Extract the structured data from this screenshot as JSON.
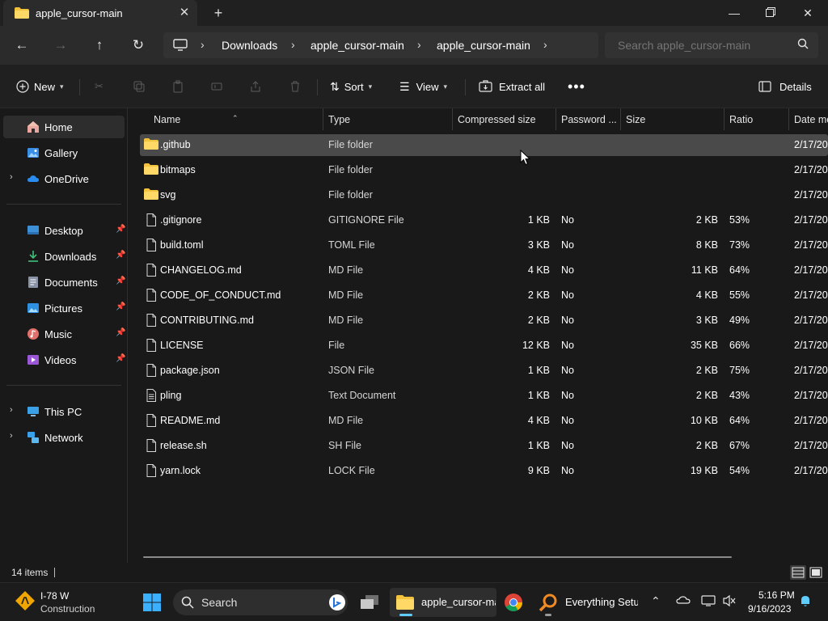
{
  "window": {
    "tab_title": "apple_cursor-main"
  },
  "address": {
    "crumbs": [
      "Downloads",
      "apple_cursor-main",
      "apple_cursor-main"
    ],
    "search_placeholder": "Search apple_cursor-main"
  },
  "toolbar": {
    "new_label": "New",
    "sort_label": "Sort",
    "view_label": "View",
    "extract_label": "Extract all",
    "details_label": "Details"
  },
  "sidebar": {
    "items": [
      {
        "label": "Home"
      },
      {
        "label": "Gallery"
      },
      {
        "label": "OneDrive"
      },
      {
        "label": "Desktop"
      },
      {
        "label": "Downloads"
      },
      {
        "label": "Documents"
      },
      {
        "label": "Pictures"
      },
      {
        "label": "Music"
      },
      {
        "label": "Videos"
      },
      {
        "label": "This PC"
      },
      {
        "label": "Network"
      }
    ]
  },
  "columns": [
    "Name",
    "Type",
    "Compressed size",
    "Password ...",
    "Size",
    "Ratio",
    "Date mo"
  ],
  "files": [
    {
      "name": ".github",
      "type": "File folder",
      "compressed": "",
      "password": "",
      "size": "",
      "ratio": "",
      "date": "2/17/202"
    },
    {
      "name": "bitmaps",
      "type": "File folder",
      "compressed": "",
      "password": "",
      "size": "",
      "ratio": "",
      "date": "2/17/202"
    },
    {
      "name": "svg",
      "type": "File folder",
      "compressed": "",
      "password": "",
      "size": "",
      "ratio": "",
      "date": "2/17/202"
    },
    {
      "name": ".gitignore",
      "type": "GITIGNORE File",
      "compressed": "1 KB",
      "password": "No",
      "size": "2 KB",
      "ratio": "53%",
      "date": "2/17/202"
    },
    {
      "name": "build.toml",
      "type": "TOML File",
      "compressed": "3 KB",
      "password": "No",
      "size": "8 KB",
      "ratio": "73%",
      "date": "2/17/202"
    },
    {
      "name": "CHANGELOG.md",
      "type": "MD File",
      "compressed": "4 KB",
      "password": "No",
      "size": "11 KB",
      "ratio": "64%",
      "date": "2/17/202"
    },
    {
      "name": "CODE_OF_CONDUCT.md",
      "type": "MD File",
      "compressed": "2 KB",
      "password": "No",
      "size": "4 KB",
      "ratio": "55%",
      "date": "2/17/202"
    },
    {
      "name": "CONTRIBUTING.md",
      "type": "MD File",
      "compressed": "2 KB",
      "password": "No",
      "size": "3 KB",
      "ratio": "49%",
      "date": "2/17/202"
    },
    {
      "name": "LICENSE",
      "type": "File",
      "compressed": "12 KB",
      "password": "No",
      "size": "35 KB",
      "ratio": "66%",
      "date": "2/17/202"
    },
    {
      "name": "package.json",
      "type": "JSON File",
      "compressed": "1 KB",
      "password": "No",
      "size": "2 KB",
      "ratio": "75%",
      "date": "2/17/202"
    },
    {
      "name": "pling",
      "type": "Text Document",
      "compressed": "1 KB",
      "password": "No",
      "size": "2 KB",
      "ratio": "43%",
      "date": "2/17/202"
    },
    {
      "name": "README.md",
      "type": "MD File",
      "compressed": "4 KB",
      "password": "No",
      "size": "10 KB",
      "ratio": "64%",
      "date": "2/17/202"
    },
    {
      "name": "release.sh",
      "type": "SH File",
      "compressed": "1 KB",
      "password": "No",
      "size": "2 KB",
      "ratio": "67%",
      "date": "2/17/202"
    },
    {
      "name": "yarn.lock",
      "type": "LOCK File",
      "compressed": "9 KB",
      "password": "No",
      "size": "19 KB",
      "ratio": "54%",
      "date": "2/17/202"
    }
  ],
  "status": {
    "count": "14 items"
  },
  "taskbar": {
    "weather_title": "I-78 W",
    "weather_sub": "Construction",
    "search_label": "Search",
    "explorer_label": "apple_cursor-main",
    "everything_label": "Everything Setu",
    "time": "5:16 PM",
    "date": "9/16/2023"
  },
  "colors": {
    "folder": "#f4c33d",
    "accent": "#60cdff",
    "selected_row": "#4a4a4a"
  }
}
